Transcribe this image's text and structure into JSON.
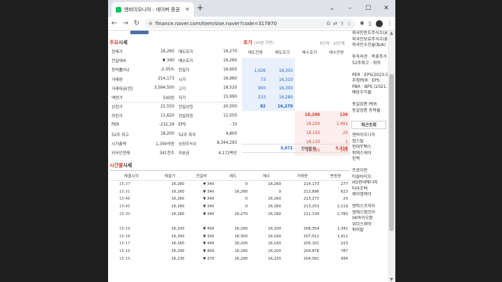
{
  "browser": {
    "tab_title": "엔비이오니아 : 네이버 증권",
    "new_tab": "+",
    "url": "finance.naver.com/item/sise.naver?code=317870",
    "win_min": "–",
    "win_max": "☐",
    "win_close": "✕"
  },
  "quote": {
    "title_hl": "주요",
    "title_rest": "시세",
    "rows": [
      {
        "l1": "현재가",
        "v1": "16,260",
        "c1": "",
        "l2": "매도호가",
        "v2": "16,270",
        "c2": ""
      },
      {
        "l1": "전일대비",
        "v1": "▼ 340",
        "c1": "dn",
        "l2": "매수호가",
        "v2": "16,260",
        "c2": ""
      },
      {
        "l1": "등락률(%)",
        "v1": "-2.05%",
        "c1": "dn",
        "l2": "전일가",
        "v2": "16,600",
        "c2": ""
      },
      {
        "l1": "거래량",
        "v1": "214,173",
        "c1": "",
        "l2": "시가",
        "v2": "16,960",
        "c2": ""
      },
      {
        "l1": "거래대금(천)",
        "v1": "3,594,500",
        "c1": "",
        "l2": "고가",
        "v2": "18,520",
        "c2": ""
      },
      {
        "l1": "액면가",
        "v1": "500원",
        "c1": "",
        "l2": "저가",
        "v2": "15,990",
        "c2": ""
      },
      {
        "l1": "상한가",
        "v1": "21,550",
        "c1": "",
        "l2": "전일상한",
        "v2": "20,500",
        "c2": "",
        "sep": true
      },
      {
        "l1": "하한가",
        "v1": "11,620",
        "c1": "",
        "l2": "전일하한",
        "v2": "11,050",
        "c2": ""
      },
      {
        "l1": "PER",
        "v1": "-232.29",
        "c1": "",
        "l2": "EPS",
        "v2": "-70",
        "c2": ""
      },
      {
        "l1": "52주 최고",
        "v1": "18,200",
        "c1": "",
        "l2": "52주 최저",
        "v2": "4,800",
        "c2": ""
      },
      {
        "l1": "시가총액",
        "v1": "1,356억원",
        "c1": "",
        "l2": "상장주식수",
        "v2": "8,344,293",
        "c2": ""
      },
      {
        "l1": "외국인현재",
        "v1": "341천주",
        "c1": "",
        "l2": "자본금",
        "v2": "4,172백만",
        "c2": ""
      }
    ]
  },
  "hoga": {
    "title": "호가",
    "subtitle": "(20분 지연)",
    "link": "· 5단계 · 10단계",
    "headers": [
      "매도잔량",
      "매도호가",
      "매수호가",
      "매수잔량"
    ],
    "asks": [
      {
        "qty": "",
        "price": ""
      },
      {
        "qty": "1,026",
        "price": "16,350"
      },
      {
        "qty": "73",
        "price": "16,310"
      },
      {
        "qty": "900",
        "price": "16,300"
      },
      {
        "qty": "233",
        "price": "16,280"
      },
      {
        "qty": "82",
        "price": "16,270"
      }
    ],
    "bids": [
      {
        "price": "16,260",
        "qty": "136"
      },
      {
        "price": "16,200",
        "qty": "1,491"
      },
      {
        "price": "16,150",
        "qty": "25"
      },
      {
        "price": "16,130",
        "qty": "1"
      },
      {
        "price": "16,120",
        "qty": "549"
      }
    ],
    "total_ask": "3,072",
    "total_label": "잔량합계",
    "total_bid": "3,316"
  },
  "timeseries": {
    "title_hl": "시간별",
    "title_rest": "시세",
    "headers": [
      "체결시각",
      "체결가",
      "전일비",
      "매도",
      "매수",
      "거래량",
      "변동량"
    ],
    "group1": [
      {
        "t": "15:37",
        "p": "16,260",
        "d": "▼ 340",
        "s": "0",
        "b": "16,260",
        "v": "214,173",
        "c": "277"
      },
      {
        "t": "15:31",
        "p": "16,260",
        "d": "▼ 340",
        "s": "16,260",
        "b": "0",
        "v": "213,896",
        "c": "623"
      },
      {
        "t": "15:46",
        "p": "16,260",
        "d": "▼ 340",
        "s": "0",
        "b": "16,260",
        "v": "213,273",
        "c": "20"
      },
      {
        "t": "15:45",
        "p": "16,260",
        "d": "▼ 340",
        "s": "0",
        "b": "16,260",
        "v": "213,253",
        "c": "2,119"
      },
      {
        "t": "15:30",
        "p": "16,260",
        "d": "▼ 340",
        "s": "16,270",
        "b": "16,260",
        "v": "211,134",
        "c": "2,780"
      }
    ],
    "group2": [
      {
        "t": "15:19",
        "p": "16,200",
        "d": "▼ 400",
        "s": "16,260",
        "b": "16,200",
        "v": "208,354",
        "c": "1,342"
      },
      {
        "t": "15:18",
        "p": "16,300",
        "d": "▼ 300",
        "s": "16,300",
        "b": "16,160",
        "v": "207,012",
        "c": "1,911"
      },
      {
        "t": "15:17",
        "p": "16,160",
        "d": "▼ 440",
        "s": "16,200",
        "b": "16,160",
        "v": "205,101",
        "c": "223"
      },
      {
        "t": "15:16",
        "p": "16,200",
        "d": "▼ 400",
        "s": "16,260",
        "b": "16,200",
        "v": "204,878",
        "c": "787"
      },
      {
        "t": "15:15",
        "p": "16,230",
        "d": "▼ 370",
        "s": "16,290",
        "b": "16,220",
        "v": "204,091",
        "c": "994"
      }
    ]
  },
  "side": {
    "top": [
      "외국인한도주식수(A)",
      "외국인보유주식수(B)",
      "외국인소진율(B/A)",
      "",
      "투자의견 · 목표주가",
      "52주최고 · 최저",
      "",
      "PER · EPS(2023.02)",
      "추정PER · EPS",
      "PBR · BPS (2021.03)",
      "배당수익률",
      "",
      "동일업종 PER",
      "동일업종 등락률"
    ],
    "recent_title": "최근조회",
    "recent": [
      "엔비이오니아",
      "힘스틸",
      "현대무벡스",
      "피에스케이",
      "된백",
      "",
      "프로이천",
      "티움바이오",
      "HD현대에너지",
      "타라조텍",
      "제이엠케이",
      "",
      "엔피스코리아",
      "엠에스캠코리",
      "SK바이오팜",
      "위더스제약",
      "파이랄"
    ]
  }
}
